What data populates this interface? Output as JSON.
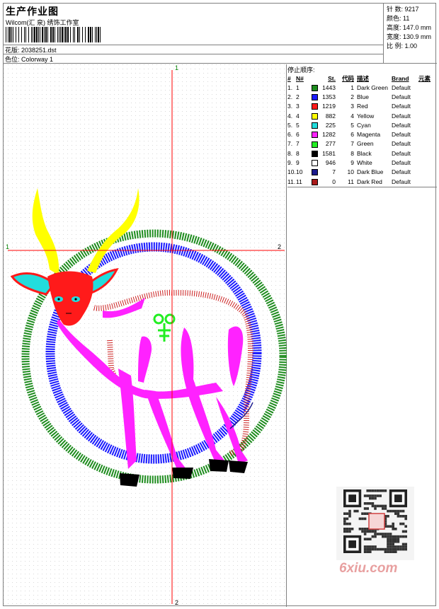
{
  "header": {
    "title": "生产作业图",
    "subtitle": "Wilcom(汇 泉) 绣饰工作室",
    "design_label": "花版: 2038251.dst",
    "colorway_label": "色位: Colorway 1"
  },
  "stats": [
    {
      "label": "针 数",
      "value": "9217"
    },
    {
      "label": "颜色",
      "value": "11"
    },
    {
      "label": "高度",
      "value": "147.0 mm"
    },
    {
      "label": "宽度",
      "value": "130.9 mm"
    },
    {
      "label": "比 例",
      "value": "1.00"
    }
  ],
  "axis_labels": {
    "top": "1",
    "bottom": "2",
    "left": "1",
    "right": "2"
  },
  "stop_sequence": {
    "title": "停止顺序:",
    "columns": [
      "#",
      "N#",
      "",
      "St.",
      "代码",
      "描述",
      "Brand",
      "元素"
    ],
    "rows": [
      {
        "n": "1.",
        "needle": "1",
        "color": "#1e8c1e",
        "stitches": "1443",
        "code": "1",
        "desc": "Dark Green",
        "brand": "Default"
      },
      {
        "n": "2.",
        "needle": "2",
        "color": "#1a1aff",
        "stitches": "1353",
        "code": "2",
        "desc": "Blue",
        "brand": "Default"
      },
      {
        "n": "3.",
        "needle": "3",
        "color": "#ff1a1a",
        "stitches": "1219",
        "code": "3",
        "desc": "Red",
        "brand": "Default"
      },
      {
        "n": "4.",
        "needle": "4",
        "color": "#ffff00",
        "stitches": "882",
        "code": "4",
        "desc": "Yellow",
        "brand": "Default"
      },
      {
        "n": "5.",
        "needle": "5",
        "color": "#22dddd",
        "stitches": "225",
        "code": "5",
        "desc": "Cyan",
        "brand": "Default"
      },
      {
        "n": "6.",
        "needle": "6",
        "color": "#ff22ff",
        "stitches": "1282",
        "code": "6",
        "desc": "Magenta",
        "brand": "Default"
      },
      {
        "n": "7.",
        "needle": "7",
        "color": "#22ee22",
        "stitches": "277",
        "code": "7",
        "desc": "Green",
        "brand": "Default"
      },
      {
        "n": "8.",
        "needle": "8",
        "color": "#000000",
        "stitches": "1581",
        "code": "8",
        "desc": "Black",
        "brand": "Default"
      },
      {
        "n": "9.",
        "needle": "9",
        "color": "#ffffff",
        "stitches": "946",
        "code": "9",
        "desc": "White",
        "brand": "Default"
      },
      {
        "n": "10.",
        "needle": "10",
        "color": "#1a1a8c",
        "stitches": "7",
        "code": "10",
        "desc": "Dark Blue",
        "brand": "Default"
      },
      {
        "n": "11.",
        "needle": "11",
        "color": "#aa1a1a",
        "stitches": "0",
        "code": "11",
        "desc": "Dark Red",
        "brand": "Default"
      }
    ]
  },
  "watermark": "6xiu.com"
}
